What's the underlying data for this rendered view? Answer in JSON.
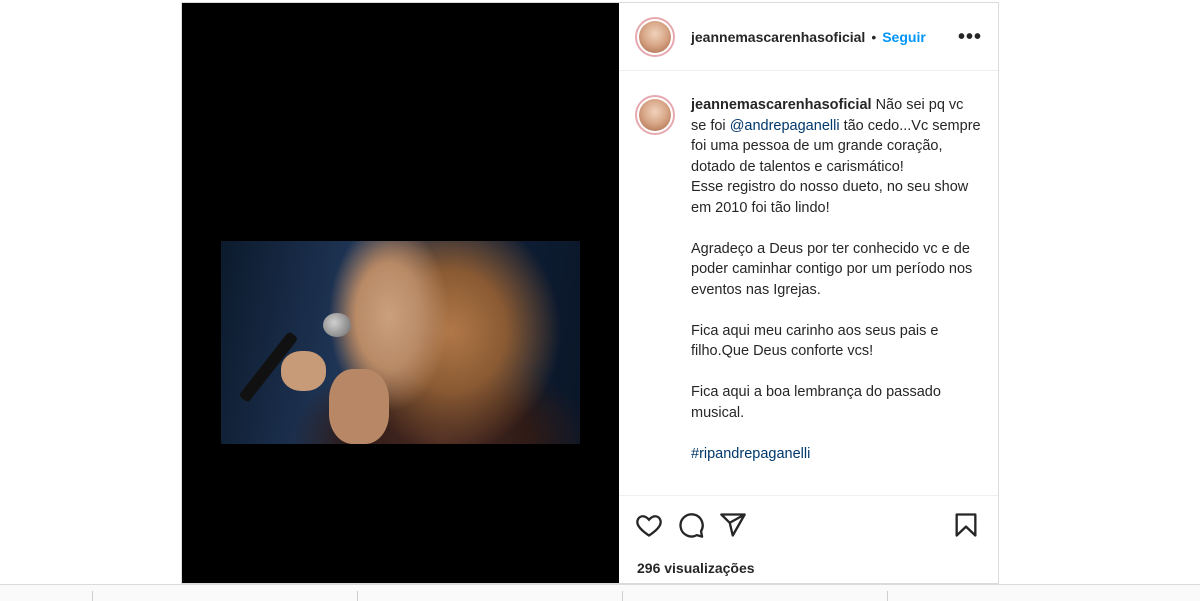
{
  "post": {
    "username": "jeannemascarenhasoficial",
    "separator": "•",
    "follow_label": "Seguir",
    "more_label": "•••",
    "caption": {
      "username": "jeannemascarenhasoficial",
      "part1": " Não sei pq vc se foi ",
      "mention": "@andrepaganelli",
      "part2": " tão cedo...Vc sempre foi uma pessoa de um grande coração, dotado de talentos e carismático!\nEsse registro do nosso dueto, no seu show em 2010 foi tão lindo!\n\nAgradeço a Deus por ter conhecido vc e de poder caminhar contigo por um período nos eventos nas Igrejas.\n\nFica aqui meu carinho aos seus pais e filho.Que Deus conforte vcs!\n\nFica aqui a boa lembrança do passado musical.\n\n",
      "hashtag": "#ripandrepaganelli"
    },
    "views": "296 visualizações"
  },
  "icons": {
    "like": "heart-icon",
    "comment": "comment-icon",
    "share": "paper-plane-icon",
    "save": "bookmark-icon"
  }
}
